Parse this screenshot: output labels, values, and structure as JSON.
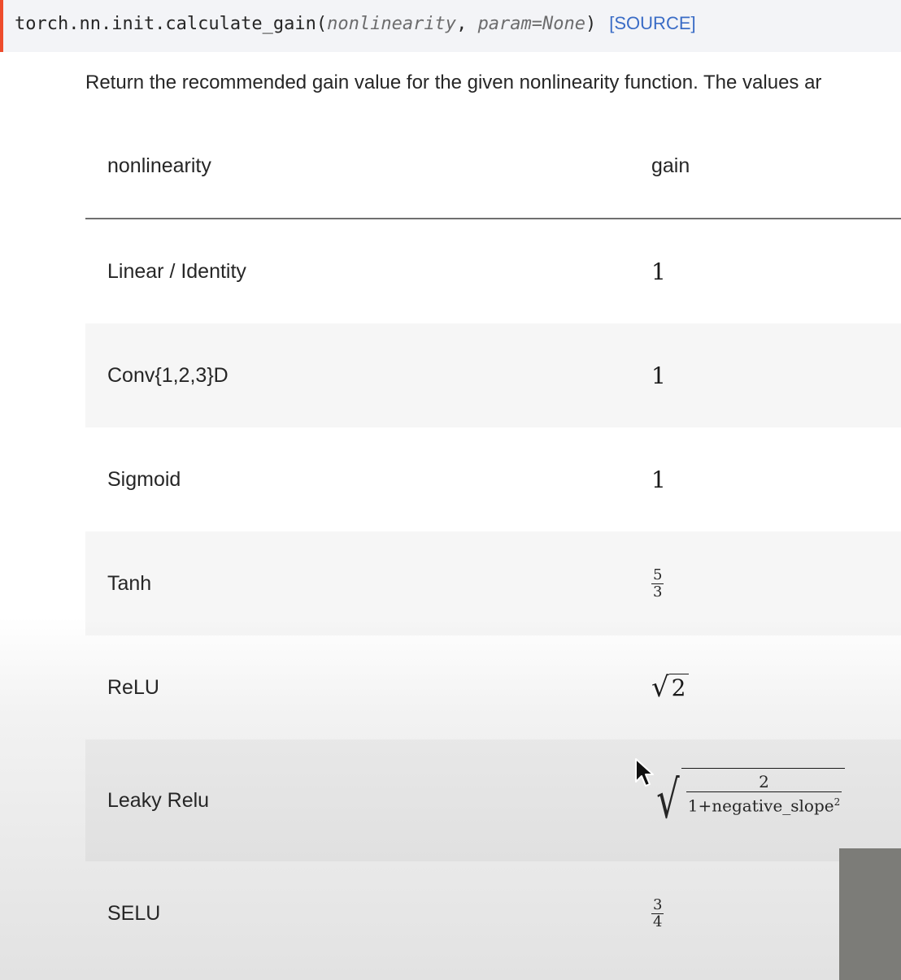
{
  "signature": {
    "prefix": "torch.nn.init.calculate_gain(",
    "param1": "nonlinearity",
    "sep": ", ",
    "param2": "param=None",
    "suffix": ")",
    "source_label": "[SOURCE]"
  },
  "description": "Return the recommended gain value for the given nonlinearity function. The values ar",
  "table": {
    "headers": [
      "nonlinearity",
      "gain"
    ],
    "rows": [
      {
        "name": "Linear / Identity",
        "gain": "1"
      },
      {
        "name": "Conv{1,2,3}D",
        "gain": "1"
      },
      {
        "name": "Sigmoid",
        "gain": "1"
      },
      {
        "name": "Tanh",
        "gain_num": "5",
        "gain_den": "3"
      },
      {
        "name": "ReLU",
        "gain_radicand": "2"
      },
      {
        "name": "Leaky Relu",
        "gain_num": "2",
        "gain_den": "1+negative_slope",
        "gain_den_exp": "2"
      },
      {
        "name": "SELU",
        "gain_num": "3",
        "gain_den": "4"
      }
    ]
  },
  "icons": {
    "cursor": "mouse-pointer-icon"
  },
  "colors": {
    "accent_bar": "#ee4c2c",
    "source_link": "#3a6cc6",
    "header_rule": "#6f6f6f"
  }
}
